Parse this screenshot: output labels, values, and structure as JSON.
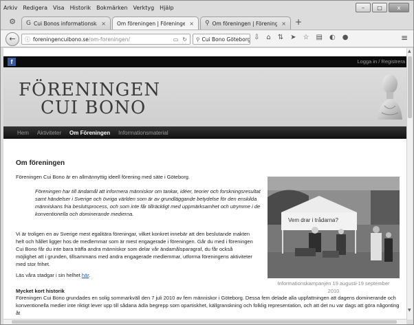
{
  "menu": [
    "Arkiv",
    "Redigera",
    "Visa",
    "Historik",
    "Bokmärken",
    "Verktyg",
    "Hjälp"
  ],
  "window_controls": {
    "minimize": "–",
    "maximize": "□",
    "close": "x"
  },
  "tabs": [
    {
      "label": "Cui Bonos informationska...",
      "icon": "g-icon",
      "active": false
    },
    {
      "label": "Om föreningen | Föreningen C...",
      "icon": "page-icon",
      "active": true
    },
    {
      "label": "Om föreningen | Föreningen C...",
      "icon": "search-icon",
      "active": false
    }
  ],
  "newtab_label": "+",
  "url": {
    "domain": "foreningencuibono.se",
    "path": "/om-foreningen/"
  },
  "search": {
    "value": "Cui Bono Göteborg"
  },
  "site": {
    "facebook": "f",
    "login": "Logga in / Registrera",
    "logo_line1": "FÖRENINGEN",
    "logo_line2": "CUI BONO",
    "nav": [
      {
        "label": "Hem",
        "current": false
      },
      {
        "label": "Aktiviteter",
        "current": false
      },
      {
        "label": "Om Föreningen",
        "current": true
      },
      {
        "label": "Informationsmaterial",
        "current": false
      }
    ]
  },
  "page": {
    "title": "Om föreningen",
    "intro": "Föreningen Cui Bono är en allmännyttig ideell förening med säte i Göteborg.",
    "quote": "Föreningen har till ändamål att informera människor om tankar, idéer, teorier och forskningsresultat samt händelser i Sverige och övriga världen som är av grundläggande betydelse för den enskilda människans fria beslutsprocess, och som inte får tillräckligt med uppmärksamhet och utrymme i de konventionella och dominerande medierna.",
    "body": "Vi är troligen en av Sverige mest egalitära föreningar, vilket konkret innebär att den beslutande makten helt och hållet ligger hos de medlemmar som är mest engagerade i föreningen. Går du med i föreningen Cui Bono får du inte bara träffa andra människor som delar vår ändamålsparagraf, du får också möjlighet att i grunden, tillsammans med andra engagerade medlemmar, utforma föreningens aktiviteter med stor frihet.",
    "statutes_prefix": "Läs våra stadgar i sin helhet ",
    "statutes_link": "här",
    "statutes_suffix": ".",
    "history_heading": "Mycket kort historik",
    "history": "Föreningen Cui Bono grundades en solig sommarkväll den 7 juli 2010 av fem människor i Göteborg. Dessa fem delade alla uppfattningen att dagens dominerande och konventionella medier inte riktigt lever upp till sådana ädla begrepp som opartiskhet, källgranskning och folklig representation, och att det nu var dags att göra någonting åt",
    "photo_sign": "Vem drar i trådarna?",
    "caption": "Informationskampanjen 19 augusti-19 september 2010"
  }
}
